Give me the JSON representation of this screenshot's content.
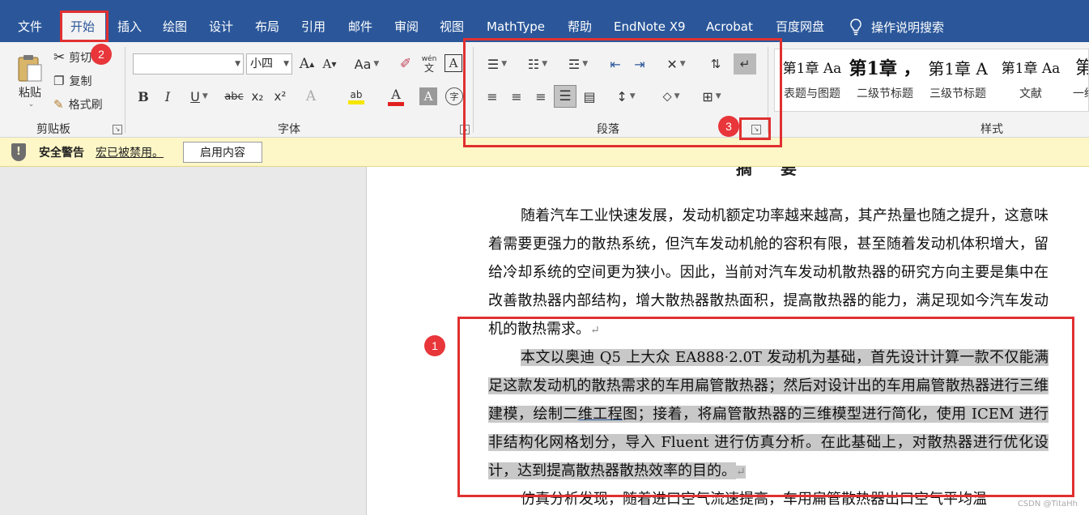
{
  "menu": {
    "file": "文件",
    "home": "开始",
    "insert": "插入",
    "draw": "绘图",
    "design": "设计",
    "layout": "布局",
    "references": "引用",
    "mailings": "邮件",
    "review": "审阅",
    "view": "视图",
    "mathtype": "MathType",
    "help": "帮助",
    "endnote": "EndNote X9",
    "acrobat": "Acrobat",
    "baidu": "百度网盘",
    "tell_me": "操作说明搜索"
  },
  "clipboard": {
    "paste": "粘贴",
    "cut": "剪切",
    "copy": "复制",
    "format_painter": "格式刷",
    "group": "剪贴板"
  },
  "font": {
    "name": "",
    "size": "小四",
    "group": "字体",
    "bold": "B",
    "italic": "I",
    "underline": "U",
    "strike": "abc",
    "sub": "x₂",
    "sup": "x²",
    "grow": "A",
    "shrink": "A",
    "case": "Aa",
    "highlight": "ab",
    "color": "A",
    "char_shade": "A",
    "enclose": "字",
    "phonetic": "wén"
  },
  "paragraph": {
    "group": "段落"
  },
  "styles": {
    "group": "样式",
    "items": [
      {
        "sample": "第1章  Aa",
        "name": "表题与图题"
      },
      {
        "sample": "第1章 ，",
        "name": "二级节标题"
      },
      {
        "sample": "第1章  A",
        "name": "三级节标题"
      },
      {
        "sample": "第1章  Aa",
        "name": "文献"
      },
      {
        "sample": "第",
        "name": "一级"
      }
    ]
  },
  "security": {
    "title": "安全警告",
    "message": "宏已被禁用。",
    "enable": "启用内容"
  },
  "document": {
    "heading": "摘  要",
    "para1": "随着汽车工业快速发展，发动机额定功率越来越高，其产热量也随之提升，这意味着需要更强力的散热系统，但汽车发动机舱的容积有限，甚至随着发动机体积增大，留给冷却系统的空间更为狭小。因此，当前对汽车发动机散热器的研究方向主要是集中在改善散热器内部结构，增大散热器散热面积，提高散热器的能力，满足现如今汽车发动机的散热需求。",
    "para2_a": "本文以奥迪 Q5 上大众 EA888·2.0T 发动机为基础，首先设计计算一款不仅能满足这款发动机的散热需求的车用扁管散热器；然后对设计出的车用扁管散热器进行三维建模，绘制二",
    "para2_u": "维工程",
    "para2_b": "图；接着，将扁管散热器的三维模型进行简化，使用 ICEM 进行非结构化网格划分，导入 Fluent 进行仿真分析。在此基础上，对散热器进行优化设计，达到提高散热器散热效率的目的。",
    "para3": "仿真分析发现，随着进口空气流速提高，车用扁管散热器出口空气平均温",
    "para_mark": "↵"
  },
  "annotations": {
    "badge1": "1",
    "badge2": "2",
    "badge3": "3"
  },
  "watermark": "CSDN @TitaHh"
}
